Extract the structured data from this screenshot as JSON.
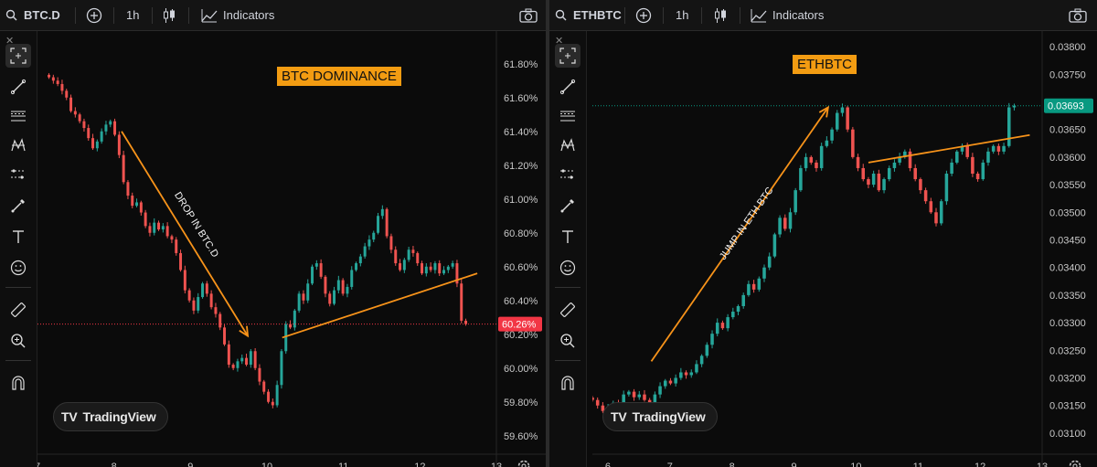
{
  "left": {
    "symbol": "BTC.D",
    "interval": "1h",
    "indicators_label": "Indicators",
    "annotation_title": "BTC DOMINANCE",
    "arrow_label": "DROP IN BTC.D",
    "price_tag": "60.26%",
    "y_ticks": [
      "61.80%",
      "61.60%",
      "61.40%",
      "61.20%",
      "61.00%",
      "60.80%",
      "60.60%",
      "60.40%",
      "60.20%",
      "60.00%",
      "59.80%",
      "59.60%"
    ],
    "x_ticks": [
      "7",
      "8",
      "9",
      "10",
      "11",
      "12",
      "13"
    ],
    "brand": "TradingView"
  },
  "right": {
    "symbol": "ETHBTC",
    "interval": "1h",
    "indicators_label": "Indicators",
    "annotation_title": "ETHBTC",
    "arrow_label": "JUMP IN ETH BTC",
    "price_tag": "0.03693",
    "y_ticks": [
      "0.03800",
      "0.03750",
      "0.03700",
      "0.03650",
      "0.03600",
      "0.03550",
      "0.03500",
      "0.03450",
      "0.03400",
      "0.03350",
      "0.03300",
      "0.03250",
      "0.03200",
      "0.03150",
      "0.03100"
    ],
    "x_ticks": [
      "6",
      "7",
      "8",
      "9",
      "10",
      "11",
      "12",
      "13"
    ],
    "brand": "TradingView"
  },
  "colors": {
    "up": "#26a69a",
    "down": "#ef5350",
    "trendline": "#f7931a",
    "price_tag_left": "#f23645",
    "price_tag_right": "#089981"
  },
  "chart_data": [
    {
      "type": "candlestick",
      "title": "BTC DOMINANCE",
      "symbol": "BTC.D",
      "x_domain": [
        7,
        13
      ],
      "ylim": [
        59.55,
        61.95
      ],
      "last": 60.26,
      "close": [
        61.72,
        61.7,
        61.68,
        61.64,
        61.6,
        61.52,
        61.5,
        61.46,
        61.42,
        61.36,
        61.3,
        61.34,
        61.4,
        61.44,
        61.46,
        61.38,
        61.26,
        61.1,
        61.02,
        60.96,
        60.98,
        60.92,
        60.84,
        60.8,
        60.86,
        60.82,
        60.84,
        60.78,
        60.76,
        60.68,
        60.58,
        60.46,
        60.4,
        60.34,
        60.42,
        60.5,
        60.44,
        60.36,
        60.32,
        60.24,
        60.14,
        60.02,
        60.0,
        60.04,
        60.06,
        60.02,
        60.1,
        60.0,
        59.92,
        59.86,
        59.8,
        59.78,
        59.9,
        60.1,
        60.26,
        60.24,
        60.34,
        60.44,
        60.4,
        60.5,
        60.6,
        60.62,
        60.54,
        60.44,
        60.38,
        60.46,
        60.52,
        60.44,
        60.48,
        60.58,
        60.62,
        60.66,
        60.72,
        60.76,
        60.8,
        60.9,
        60.94,
        60.78,
        60.7,
        60.62,
        60.58,
        60.64,
        60.7,
        60.68,
        60.62,
        60.56,
        60.6,
        60.58,
        60.62,
        60.56,
        60.58,
        60.6,
        60.62,
        60.5,
        60.28,
        60.26
      ]
    },
    {
      "type": "candlestick",
      "title": "ETHBTC",
      "symbol": "ETHBTC",
      "x_domain": [
        5.75,
        13
      ],
      "ylim": [
        0.0308,
        0.03815
      ],
      "last": 0.03693,
      "close": [
        0.0316,
        0.0315,
        0.0314,
        0.03145,
        0.03155,
        0.0315,
        0.0317,
        0.03175,
        0.03165,
        0.0317,
        0.0316,
        0.0315,
        0.0317,
        0.03185,
        0.03195,
        0.0319,
        0.032,
        0.0321,
        0.03205,
        0.0321,
        0.03225,
        0.0324,
        0.0326,
        0.0328,
        0.033,
        0.0329,
        0.0331,
        0.0332,
        0.0333,
        0.0335,
        0.0337,
        0.0336,
        0.0338,
        0.034,
        0.0342,
        0.0346,
        0.0349,
        0.0347,
        0.035,
        0.0354,
        0.0358,
        0.036,
        0.0359,
        0.0358,
        0.0362,
        0.0363,
        0.0365,
        0.0368,
        0.0369,
        0.0365,
        0.036,
        0.0358,
        0.0356,
        0.0355,
        0.0357,
        0.0354,
        0.0356,
        0.0358,
        0.0359,
        0.036,
        0.0361,
        0.0358,
        0.0356,
        0.0354,
        0.0352,
        0.035,
        0.0348,
        0.0352,
        0.0357,
        0.0359,
        0.0361,
        0.0362,
        0.036,
        0.0357,
        0.0356,
        0.0359,
        0.0361,
        0.0362,
        0.0361,
        0.0362,
        0.0369,
        0.03693
      ]
    }
  ]
}
